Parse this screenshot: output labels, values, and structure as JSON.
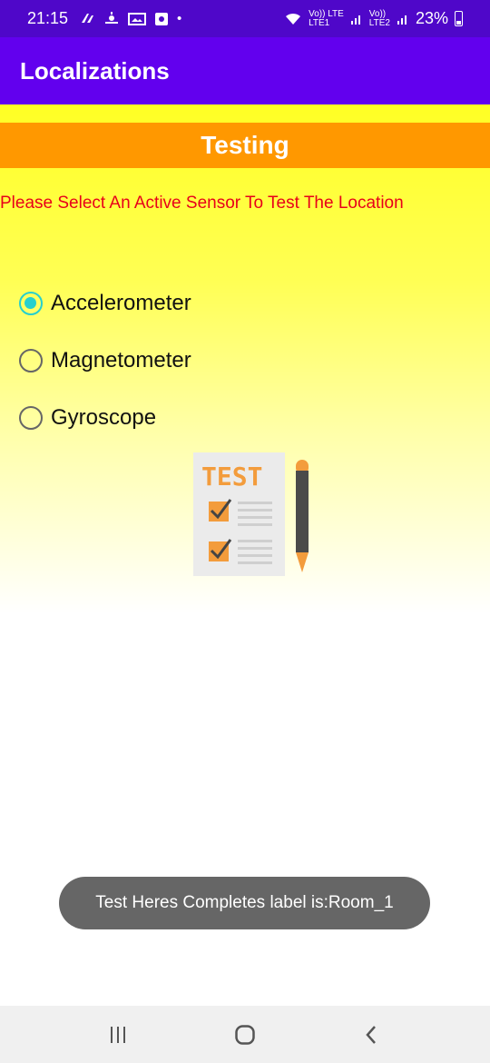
{
  "status_bar": {
    "time": "21:15",
    "network_label_1": "Vo)) LTE",
    "network_label_2": "LTE1",
    "network_label_3": "Vo))",
    "network_label_4": "LTE2",
    "battery": "23%"
  },
  "app_bar": {
    "title": "Localizations"
  },
  "banner": {
    "title": "Testing"
  },
  "instruction": {
    "text": "Please Select An Active Sensor To Test The Location"
  },
  "sensors": [
    {
      "label": "Accelerometer",
      "checked": true
    },
    {
      "label": "Magnetometer",
      "checked": false
    },
    {
      "label": "Gyroscope",
      "checked": false
    }
  ],
  "illustration": {
    "text": "TEST"
  },
  "toast": {
    "message": "Test Heres Completes label is:Room_1"
  },
  "colors": {
    "status_bar": "#4f07c9",
    "app_bar": "#6200ee",
    "banner": "#ff9800",
    "instruction_text": "#e8001a",
    "radio_checked": "#26d0ce",
    "toast_bg": "#666666"
  },
  "nav_icons": [
    "recent-apps-icon",
    "home-icon",
    "back-icon"
  ]
}
